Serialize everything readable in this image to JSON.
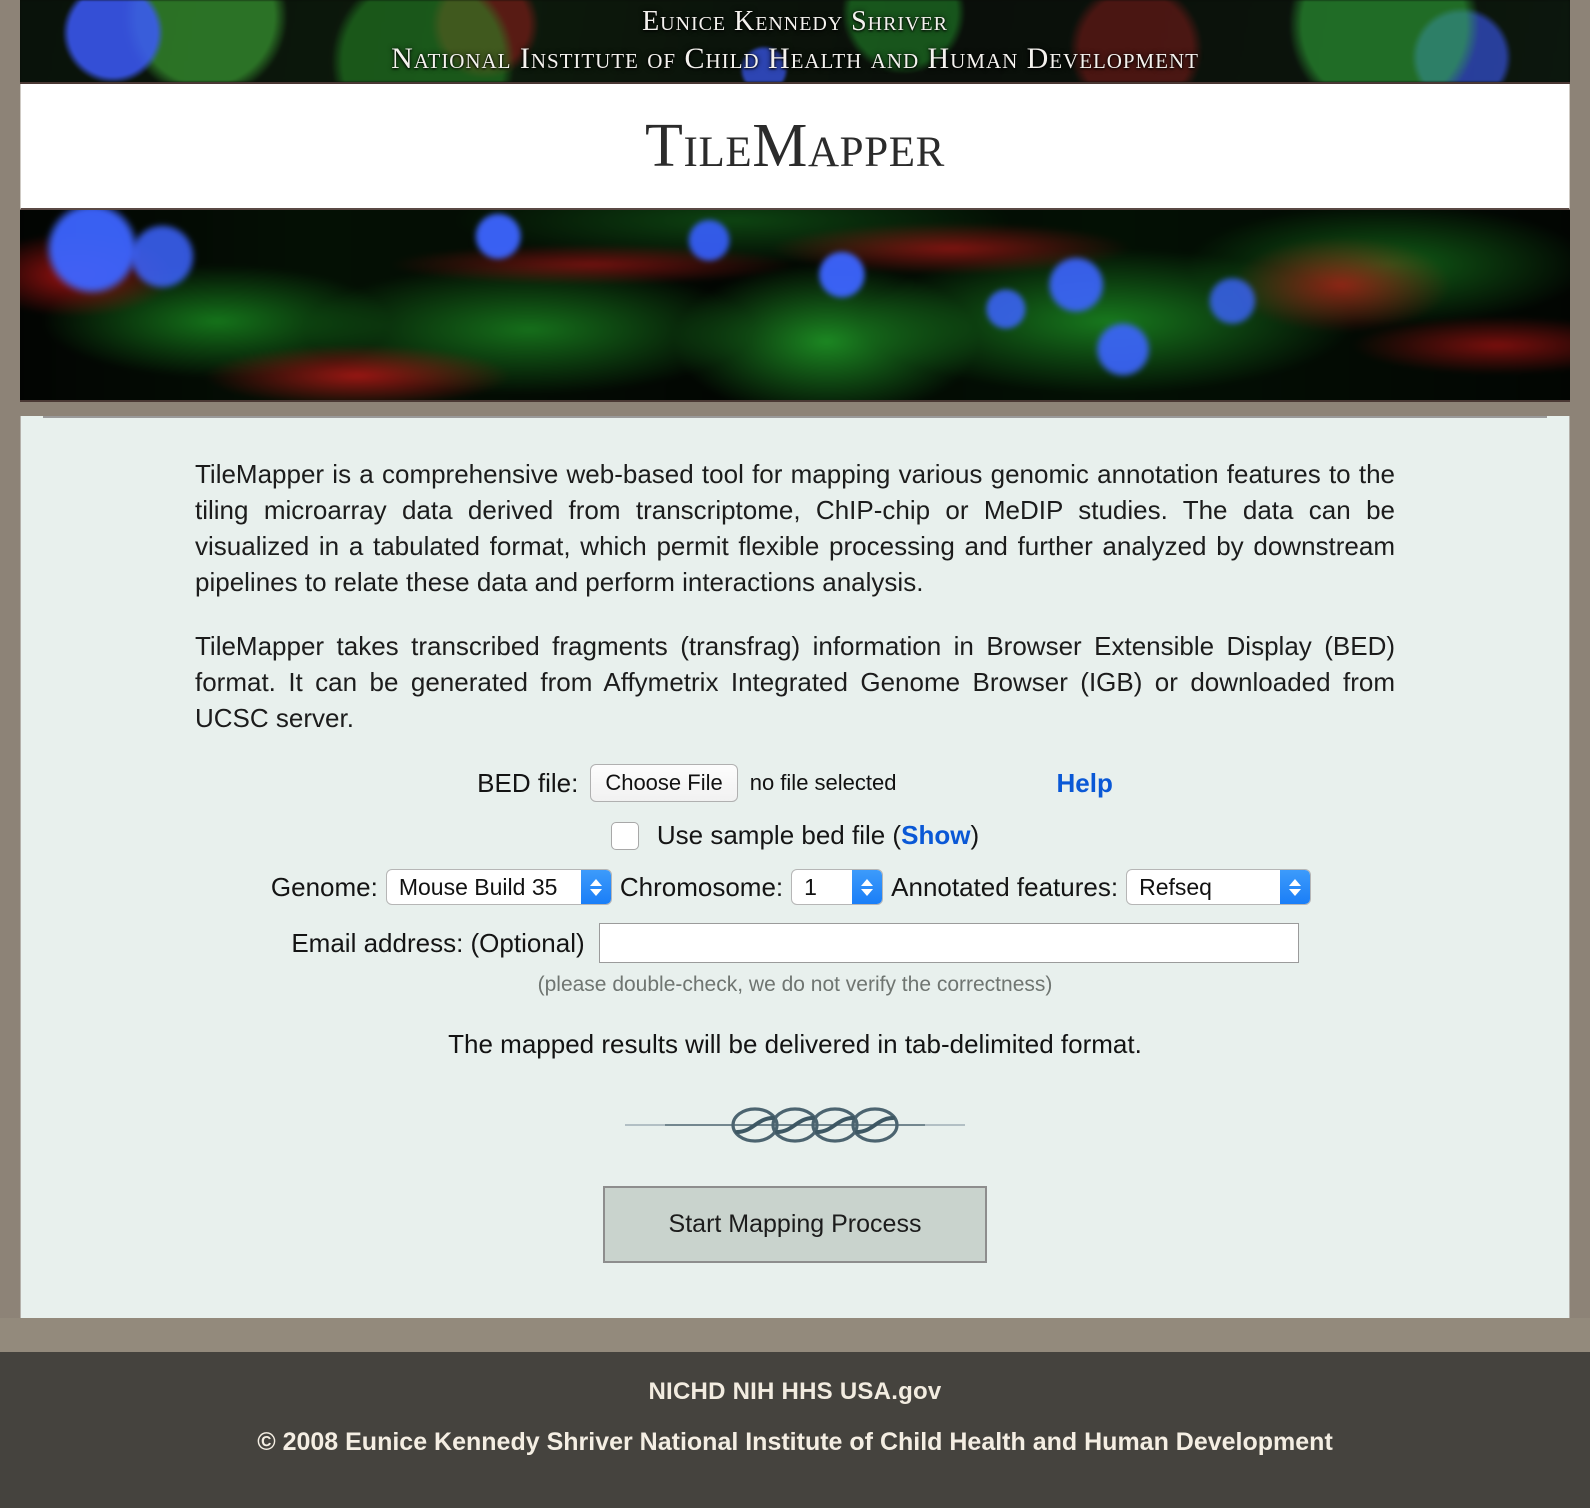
{
  "banner": {
    "line1": "Eunice Kennedy Shriver",
    "line2": "National Institute of Child Health and Human Development"
  },
  "title": "TileMapper",
  "intro": {
    "paragraph1": "TileMapper is a comprehensive web-based tool for mapping various genomic annotation features to the tiling microarray data derived from transcriptome, ChIP-chip or MeDIP studies. The data can be visualized in a tabulated format, which permit flexible processing and further analyzed by downstream pipelines to relate these data and perform interactions analysis.",
    "paragraph2": "TileMapper takes transcribed fragments (transfrag) information in Browser Extensible Display (BED) format. It can be generated from Affymetrix Integrated Genome Browser (IGB) or downloaded from UCSC server."
  },
  "form": {
    "bed_label": "BED file:",
    "choose_file_label": "Choose File",
    "file_status": "no file selected",
    "help_label": "Help",
    "sample_checkbox_text_before": "Use sample bed file (",
    "sample_show_label": "Show",
    "sample_checkbox_text_after": ")",
    "sample_checked": false,
    "genome_label": "Genome:",
    "genome_value": "Mouse Build 35",
    "chromosome_label": "Chromosome:",
    "chromosome_value": "1",
    "features_label": "Annotated features:",
    "features_value": "Refseq",
    "email_label": "Email address: (Optional)",
    "email_value": "",
    "email_note": "(please double-check, we do not verify the correctness)",
    "delivered_note": "The mapped results will be delivered in tab-delimited format.",
    "submit_label": "Start Mapping Process"
  },
  "footer": {
    "links": "NICHD NIH HHS USA.gov",
    "copyright": "© 2008 Eunice Kennedy Shriver National Institute of Child Health and Human Development"
  },
  "colors": {
    "page_bg": "#8d8377",
    "content_bg": "#e8f0ed",
    "footer_bg": "#45433e",
    "taupe_band": "#938a7c",
    "link_blue": "#0a58d6",
    "button_bg": "#c9d3cd"
  }
}
